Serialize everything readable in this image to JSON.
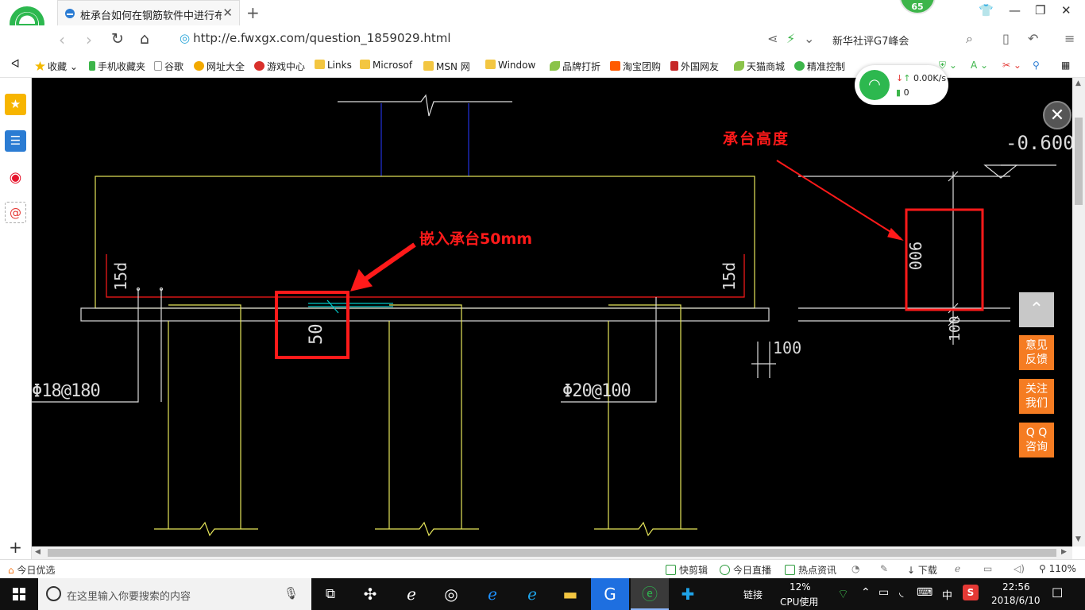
{
  "browser": {
    "tab_title": "桩承台如何在钢筋软件中进行布置",
    "tab_close": "✕",
    "new_tab": "+",
    "badge_number": "65",
    "url": "http://e.fwxgx.com/question_1859029.html",
    "search_text": "新华社评G7峰会"
  },
  "bookmarks": [
    {
      "label": "收藏",
      "icon": "star-icon",
      "color": "#f3b900"
    },
    {
      "label": "手机收藏夹",
      "icon": "phone-icon",
      "color": "#3db54a"
    },
    {
      "label": "谷歌",
      "icon": "page-icon",
      "color": "#bbbbbb"
    },
    {
      "label": "网址大全",
      "icon": "globe-icon",
      "color": "#f2a900"
    },
    {
      "label": "游戏中心",
      "icon": "game-icon",
      "color": "#d9302b"
    },
    {
      "label": "Links",
      "icon": "folder-icon",
      "color": "#f3c641"
    },
    {
      "label": "Microsof",
      "icon": "folder-icon",
      "color": "#f3c641"
    },
    {
      "label": "MSN 网",
      "icon": "folder-icon",
      "color": "#f3c641"
    },
    {
      "label": "Window",
      "icon": "folder-icon",
      "color": "#f3c641"
    },
    {
      "label": "品牌打折",
      "icon": "leaf-icon",
      "color": "#8bc34a"
    },
    {
      "label": "淘宝团购",
      "icon": "taobao-icon",
      "color": "#ff5a00"
    },
    {
      "label": "外国网友",
      "icon": "flag-icon",
      "color": "#c62828"
    },
    {
      "label": "天猫商城",
      "icon": "leaf-icon",
      "color": "#8bc34a"
    },
    {
      "label": "精准控制",
      "icon": "wechat-icon",
      "color": "#3db54a"
    }
  ],
  "wifi_popup": {
    "speed": "0.00K/s",
    "count": "0"
  },
  "cad": {
    "annotation_height": "承台高度",
    "annotation_embed": "嵌入承台50mm",
    "elevation": "-0.600",
    "dim_900": "900",
    "dim_100_vertical": "100",
    "dim_100_horizontal": "100",
    "dim_50": "50",
    "label_15d_left": "15d",
    "label_15d_right": "15d",
    "rebar_left": "Φ18@180",
    "rebar_right": "Φ20@100"
  },
  "float_buttons": {
    "feedback": "意见\n反馈",
    "follow": "关注\n我们",
    "qq": "Q Q\n咨询"
  },
  "statusbar": {
    "today": "今日优选",
    "kuaijianji": "快剪辑",
    "live": "今日直播",
    "news": "热点资讯",
    "download": "下载",
    "zoom": "110%"
  },
  "taskbar": {
    "search_placeholder": "在这里输入你要搜索的内容",
    "link_label": "链接",
    "cpu_percent": "12%",
    "cpu_label": "CPU使用",
    "ime": "中",
    "time": "22:56",
    "date": "2018/6/10"
  },
  "colors": {
    "red": "#ff1a1a",
    "cad_yellow": "#e6e65a",
    "cad_blue": "#2233dd",
    "cad_cyan": "#00c8c8",
    "orange": "#f57c22"
  }
}
